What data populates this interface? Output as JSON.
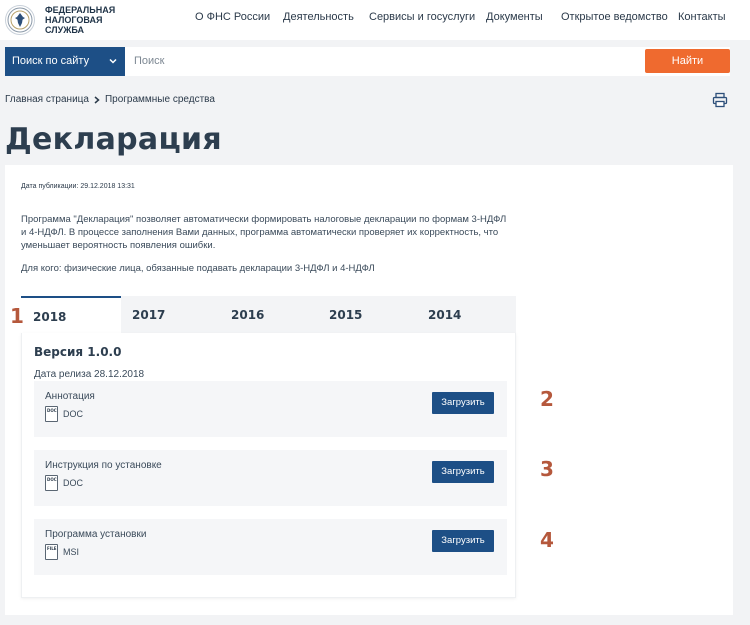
{
  "header": {
    "logo_line1": "Федеральная",
    "logo_line2": "налоговая служба",
    "nav": [
      "О ФНС России",
      "Деятельность",
      "Сервисы и госуслуги",
      "Документы",
      "Открытое ведомство",
      "Контакты"
    ]
  },
  "search": {
    "scope_label": "Поиск по сайту",
    "placeholder": "Поиск",
    "button_label": "Найти"
  },
  "breadcrumb": {
    "home": "Главная страница",
    "current": "Программные средства"
  },
  "page_title": "Декларация",
  "article": {
    "pub_date": "Дата публикации: 29.12.2018 13:31",
    "description_line1": "Программа \"Декларация\" позволяет автоматически формировать налоговые декларации по формам 3-НДФЛ",
    "description_line2": "и 4-НДФЛ. В процессе заполнения Вами данных, программа автоматически проверяет их корректность, что",
    "description_line3": "уменьшает вероятность появления ошибки.",
    "for_whom": "Для кого: физические лица, обязанные подавать декларации 3-НДФЛ и 4-НДФЛ"
  },
  "tabs": [
    "2018",
    "2017",
    "2016",
    "2015",
    "2014"
  ],
  "active_tab": "2018",
  "panel": {
    "version": "Версия 1.0.0",
    "release_date": "Дата релиза 28.12.2018",
    "files": [
      {
        "title": "Аннотация",
        "icon_label": "DOC",
        "ext": "DOC",
        "button": "Загрузить"
      },
      {
        "title": "Инструкция по установке",
        "icon_label": "DOC",
        "ext": "DOC",
        "button": "Загрузить"
      },
      {
        "title": "Программа установки",
        "icon_label": "FILE",
        "ext": "MSI",
        "button": "Загрузить"
      }
    ]
  },
  "markers": [
    "1",
    "2",
    "3",
    "4"
  ],
  "colors": {
    "brand_blue": "#1d4f86",
    "accent_orange": "#ef6a2f",
    "marker_red": "#b5583c"
  }
}
